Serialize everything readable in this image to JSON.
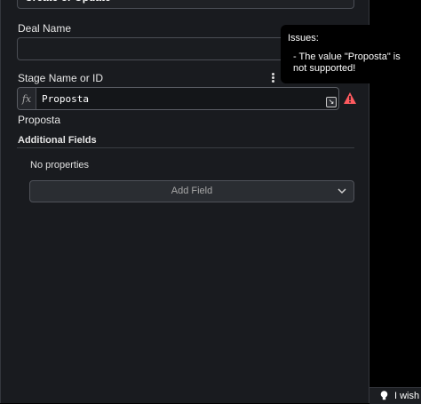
{
  "panel": {
    "top_field_value": "Create or Update",
    "deal_name": {
      "label": "Deal Name",
      "value": ""
    },
    "stage": {
      "label": "Stage Name or ID",
      "fx_label": "fx",
      "expression": "Proposta",
      "resolved_value": "Proposta"
    },
    "additional_fields": {
      "label": "Additional Fields",
      "empty_text": "No properties",
      "add_button_label": "Add Field"
    }
  },
  "tooltip": {
    "title": "Issues:",
    "message": "- The value \"Proposta\" is not supported!"
  },
  "corner": {
    "label": "I wish"
  },
  "colors": {
    "panel_bg": "#191b1f",
    "warning": "#ff5a5f",
    "tooltip_bg": "#000000"
  }
}
